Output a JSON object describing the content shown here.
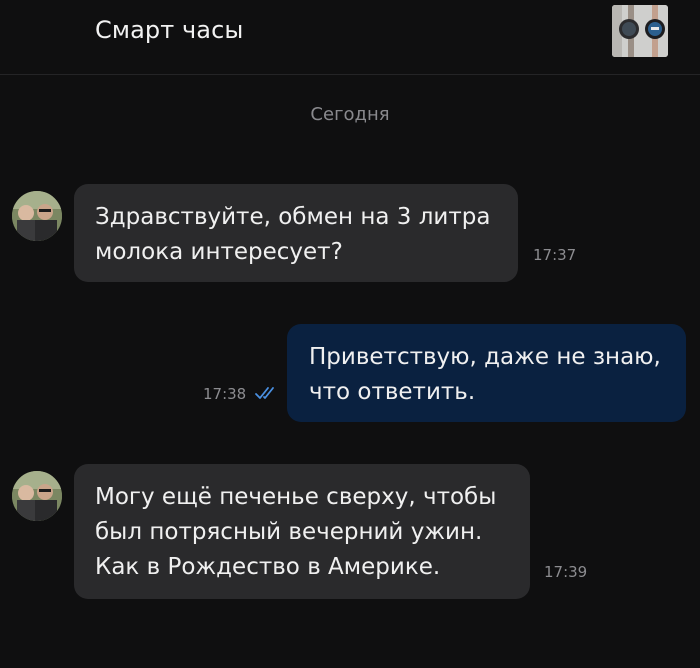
{
  "header": {
    "title": "Смарт часы"
  },
  "date_separator": "Сегодня",
  "messages": [
    {
      "direction": "incoming",
      "text": "Здравствуйте, обмен на 3 литра\nмолока интересует?",
      "time": "17:37"
    },
    {
      "direction": "outgoing",
      "text": "Приветствую, даже не знаю,\nчто ответить.",
      "time": "17:38",
      "status": "read"
    },
    {
      "direction": "incoming",
      "text": "Могу ещё печенье сверху, чтобы\nбыл потрясный вечерний ужин.\nКак в Рождество в Америке.",
      "time": "17:39"
    }
  ],
  "colors": {
    "background": "#0f0f10",
    "incoming_bubble": "#2a2a2c",
    "outgoing_bubble": "#0a2140",
    "read_check": "#4a90e2",
    "muted_text": "#8c8c90"
  },
  "icons": {
    "read_status": "double-check-icon"
  }
}
